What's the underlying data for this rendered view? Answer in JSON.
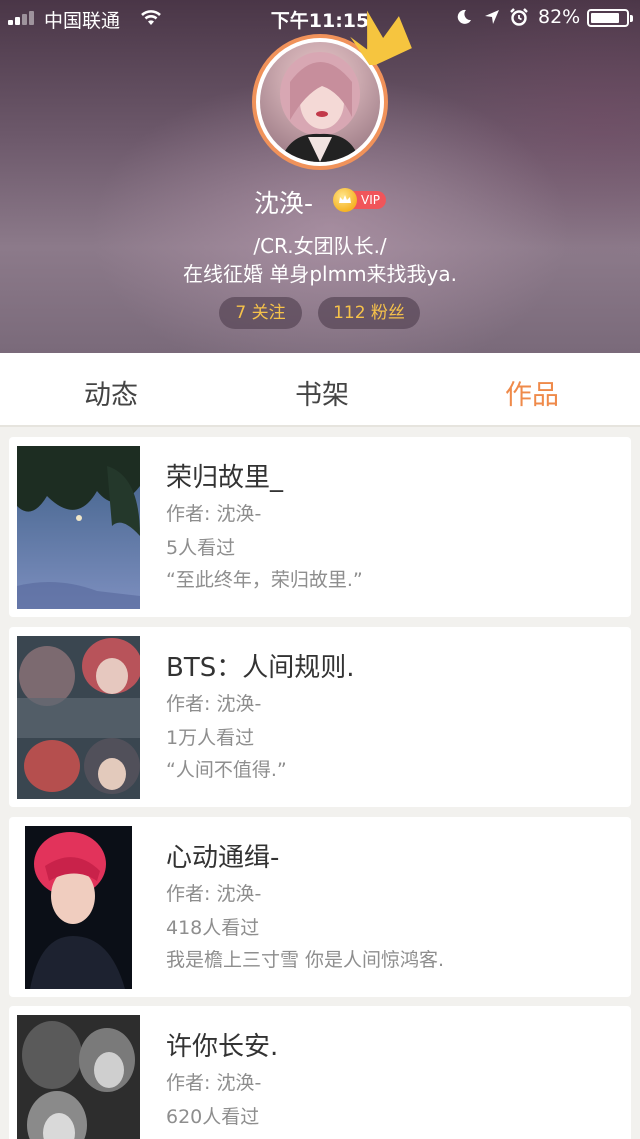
{
  "status_bar": {
    "carrier": "中国联通",
    "time": "下午11:15",
    "battery_percent": "82%",
    "battery_level": 0.82
  },
  "profile": {
    "username": "沈涣-",
    "vip_label": "VIP",
    "bio_line1": "/CR.女团队长./",
    "bio_line2": "在线征婚 单身plmm来找我ya.",
    "following": "7 关注",
    "followers": "112 粉丝"
  },
  "tabs": [
    {
      "label": "动态"
    },
    {
      "label": "书架"
    },
    {
      "label": "作品"
    }
  ],
  "colors": {
    "accent": "#ef8a4a",
    "stat_text": "#f6c24a",
    "vip_red": "#f0555a"
  },
  "works": [
    {
      "title": "荣归故里_",
      "author": "作者: 沈涣-",
      "views": "5人看过",
      "desc": "“至此终年，荣归故里.”"
    },
    {
      "title": "BTS：人间规则.",
      "author": "作者: 沈涣-",
      "views": "1万人看过",
      "desc": "“人间不值得.”"
    },
    {
      "title": "心动通缉-",
      "author": "作者: 沈涣-",
      "views": "418人看过",
      "desc": "我是檐上三寸雪 你是人间惊鸿客."
    },
    {
      "title": "许你长安.",
      "author": "作者: 沈涣-",
      "views": "620人看过",
      "desc": ""
    }
  ]
}
